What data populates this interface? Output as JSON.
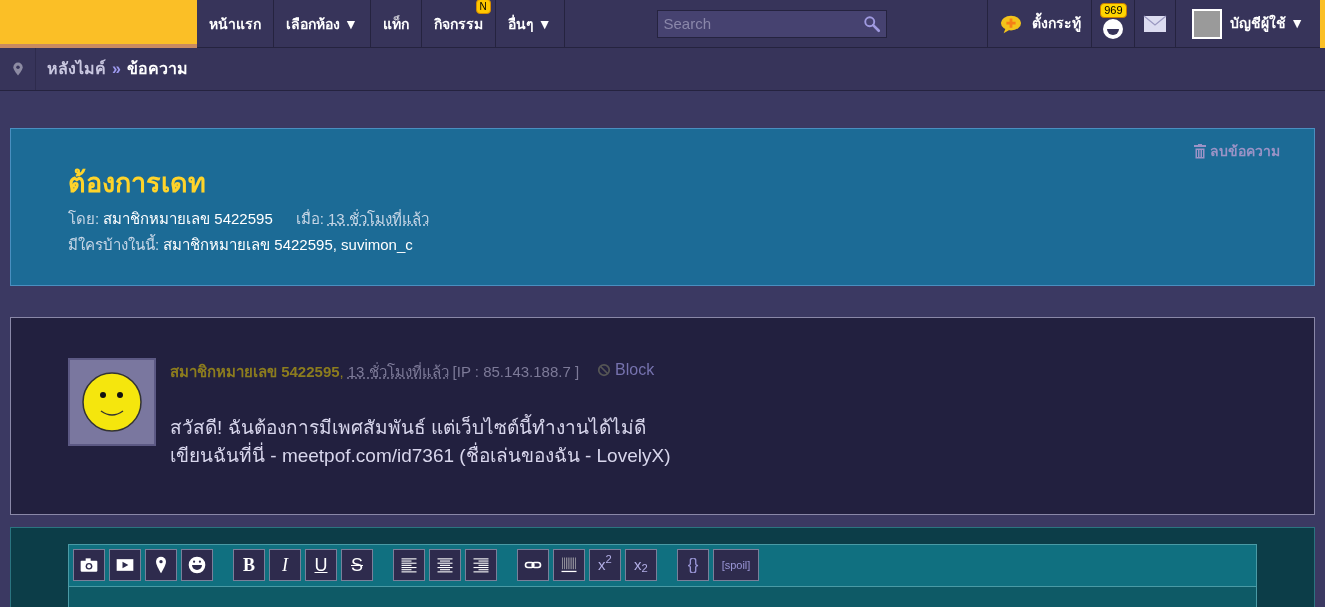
{
  "nav": {
    "items": [
      {
        "label": "หน้าแรก"
      },
      {
        "label": "เลือกห้อง ▼"
      },
      {
        "label": "แท็ก"
      },
      {
        "label": "กิจกรรม",
        "badge": "N"
      },
      {
        "label": "อื่นๆ ▼"
      }
    ],
    "search": {
      "placeholder": "Search"
    },
    "new_topic": "ตั้งกระทู้",
    "notifications": "969",
    "account": "บัญชีผู้ใช้ ▼"
  },
  "breadcrumb": [
    "หลังไมค์",
    "»",
    "ข้อความ"
  ],
  "message": {
    "delete": "ลบข้อความ",
    "title": "ต้องการเดท",
    "by_label": "โดย:",
    "by": "สมาชิกหมายเลข 5422595",
    "when_label": "เมื่อ:",
    "when": "13 ชั่วโมงที่แล้ว",
    "members_label": "มีใครบ้างในนี้:",
    "members": "สมาชิกหมายเลข 5422595, suvimon_c"
  },
  "post": {
    "author": "สมาชิกหมายเลข 5422595",
    "sep": ",",
    "time": "13 ชั่วโมงที่แล้ว",
    "ip": "[IP : 85.143.188.7 ]",
    "block": "Block",
    "lines": [
      "สวัสดี! ฉันต้องการมีเพศสัมพันธ์ แต่เว็บไซต์นี้ทำงานได้ไม่ดี",
      "เขียนฉันที่นี่ - meetpof.com/id7361 (ชื่อเล่นของฉัน - LovelyX)"
    ]
  },
  "toolbar": [
    [
      {
        "kind": "icon"
      },
      {
        "kind": "icon"
      },
      {
        "kind": "icon"
      },
      {
        "kind": "icon"
      }
    ],
    [
      {
        "kind": "text",
        "label": "B"
      },
      {
        "kind": "text",
        "label": "I"
      },
      {
        "kind": "text",
        "label": "U"
      },
      {
        "kind": "text",
        "label": "S"
      }
    ],
    [
      {
        "kind": "icon"
      },
      {
        "kind": "icon"
      },
      {
        "kind": "icon"
      }
    ],
    [
      {
        "kind": "icon"
      },
      {
        "kind": "icon"
      },
      {
        "kind": "text",
        "label": "x$^{2}$"
      },
      {
        "kind": "text",
        "label": "x$_{2}$"
      }
    ],
    [
      {
        "kind": "text",
        "label": "{}"
      },
      {
        "kind": "text",
        "label": "[spoil]"
      }
    ]
  ]
}
